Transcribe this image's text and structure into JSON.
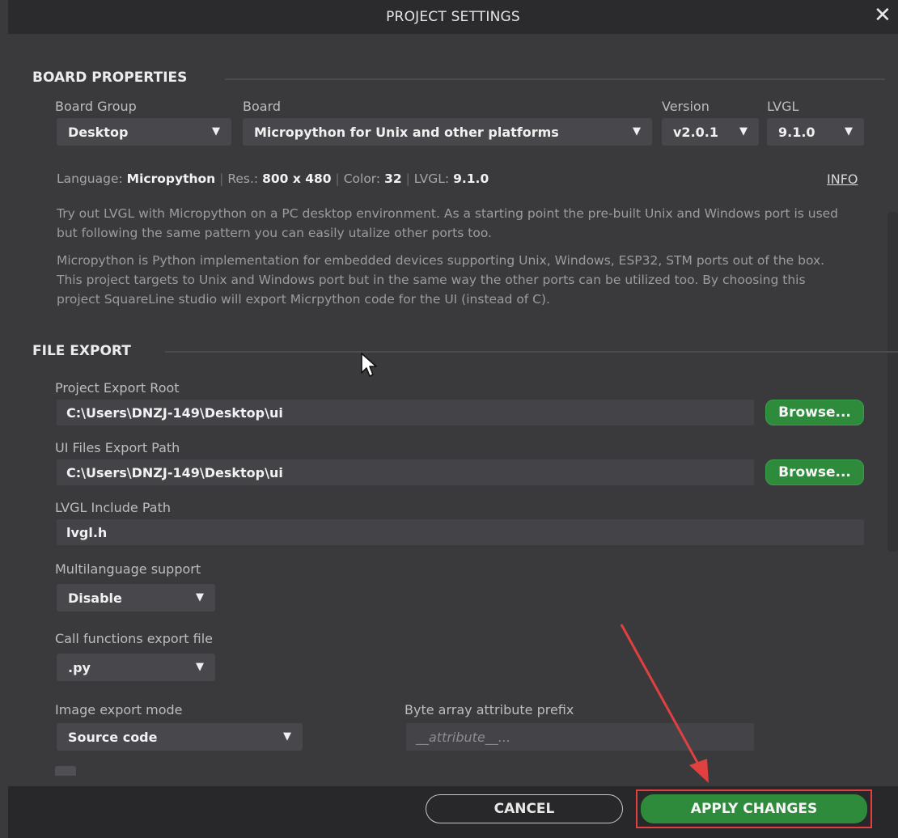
{
  "dialog": {
    "title": "PROJECT SETTINGS"
  },
  "board_properties": {
    "header": "BOARD PROPERTIES",
    "board_group": {
      "label": "Board Group",
      "value": "Desktop"
    },
    "board": {
      "label": "Board",
      "value": "Micropython for Unix and other platforms"
    },
    "version": {
      "label": "Version",
      "value": "v2.0.1"
    },
    "lvgl": {
      "label": "LVGL",
      "value": "9.1.0"
    },
    "info": {
      "language_label": "Language:",
      "language_value": "Micropython",
      "res_label": "Res.:",
      "res_value": "800 x 480",
      "color_label": "Color:",
      "color_value": "32",
      "lvgl_label": "LVGL:",
      "lvgl_value": "9.1.0",
      "separator": "|",
      "info_link": "INFO"
    },
    "description_1": "Try out LVGL with Micropython on a PC desktop environment. As a starting point the pre-built Unix and Windows port is used but following the same pattern you can easily utalize other ports too.",
    "description_2": "Micropython is Python implementation for embedded devices supporting Unix, Windows, ESP32, STM ports out of the box. This project targets to Unix and Windows port but in the same way the other ports can be utilized too. By choosing this project SquareLine studio will export Micrpython code for the UI (instead of C)."
  },
  "file_export": {
    "header": "FILE EXPORT",
    "project_export_root": {
      "label": "Project Export Root",
      "value": "C:\\Users\\DNZJ-149\\Desktop\\ui",
      "button": "Browse..."
    },
    "ui_files_export_path": {
      "label": "UI Files Export Path",
      "value": "C:\\Users\\DNZJ-149\\Desktop\\ui",
      "button": "Browse..."
    },
    "lvgl_include_path": {
      "label": "LVGL Include Path",
      "value": "lvgl.h"
    },
    "multilanguage": {
      "label": "Multilanguage support",
      "value": "Disable"
    },
    "call_functions": {
      "label": "Call functions export file",
      "value": ".py"
    },
    "image_export_mode": {
      "label": "Image export mode",
      "value": "Source code"
    },
    "byte_array_prefix": {
      "label": "Byte array attribute prefix",
      "placeholder": "__attribute__..."
    }
  },
  "footer": {
    "cancel": "CANCEL",
    "apply": "APPLY CHANGES"
  },
  "icons": {
    "dropdown_arrow": "▼",
    "close": "✕"
  },
  "colors": {
    "accent_green": "#2e8b3c",
    "annotation_red": "#e0403f"
  }
}
